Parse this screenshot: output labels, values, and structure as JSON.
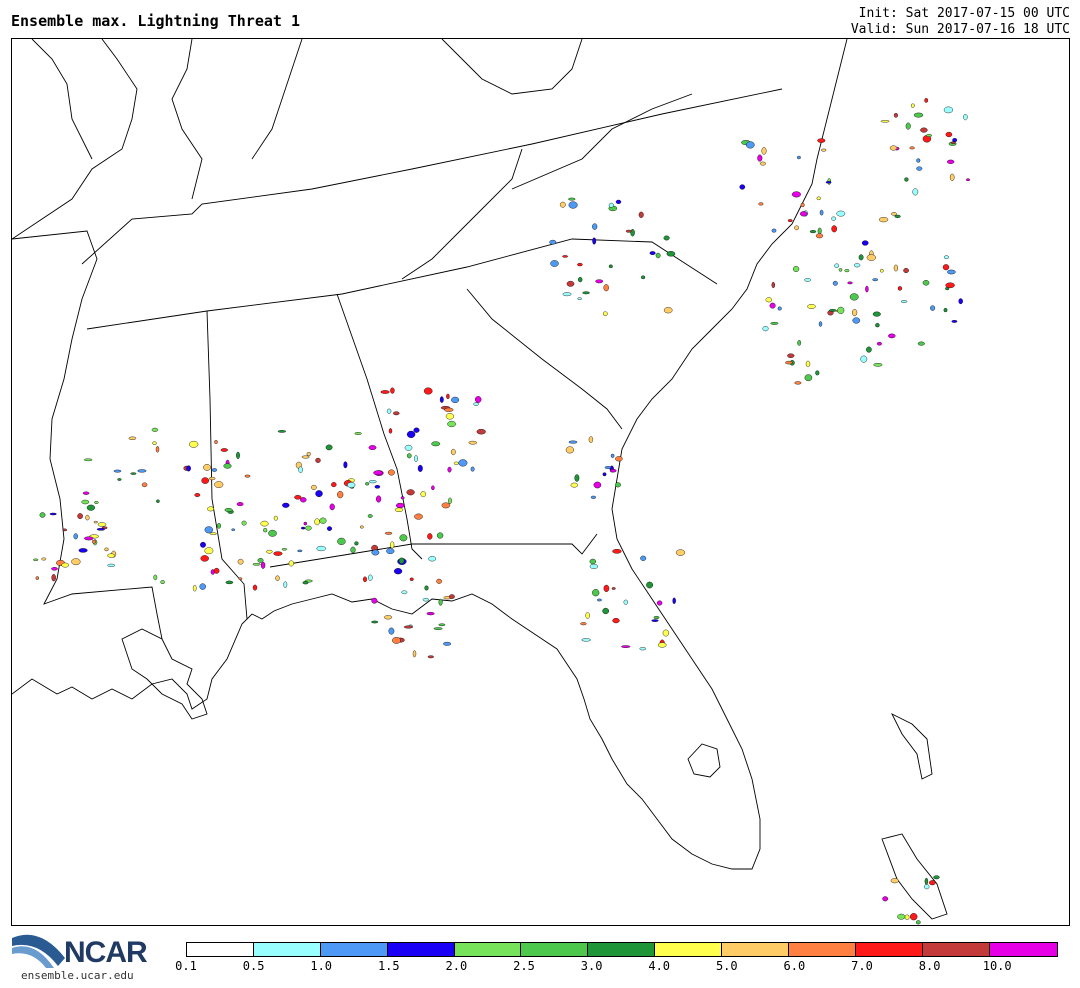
{
  "header": {
    "title": "Ensemble max. Lightning Threat 1",
    "init": "Init: Sat 2017-07-15 00 UTC",
    "valid": "Valid: Sun 2017-07-16 18 UTC"
  },
  "logo": {
    "brand": "NCAR",
    "url": "ensemble.ucar.edu"
  },
  "colorbar": {
    "colors": [
      "#ffffff",
      "#99ffff",
      "#4d99f5",
      "#1a00f5",
      "#77e35a",
      "#4dc84d",
      "#1e9637",
      "#ffff4d",
      "#ffcc66",
      "#ff8040",
      "#ff1a1a",
      "#c43a3a",
      "#e600e6"
    ],
    "labels": [
      "0.1",
      "0.5",
      "1.0",
      "1.5",
      "2.0",
      "2.5",
      "3.0",
      "4.0",
      "5.0",
      "6.0",
      "7.0",
      "8.0",
      "10.0"
    ]
  }
}
